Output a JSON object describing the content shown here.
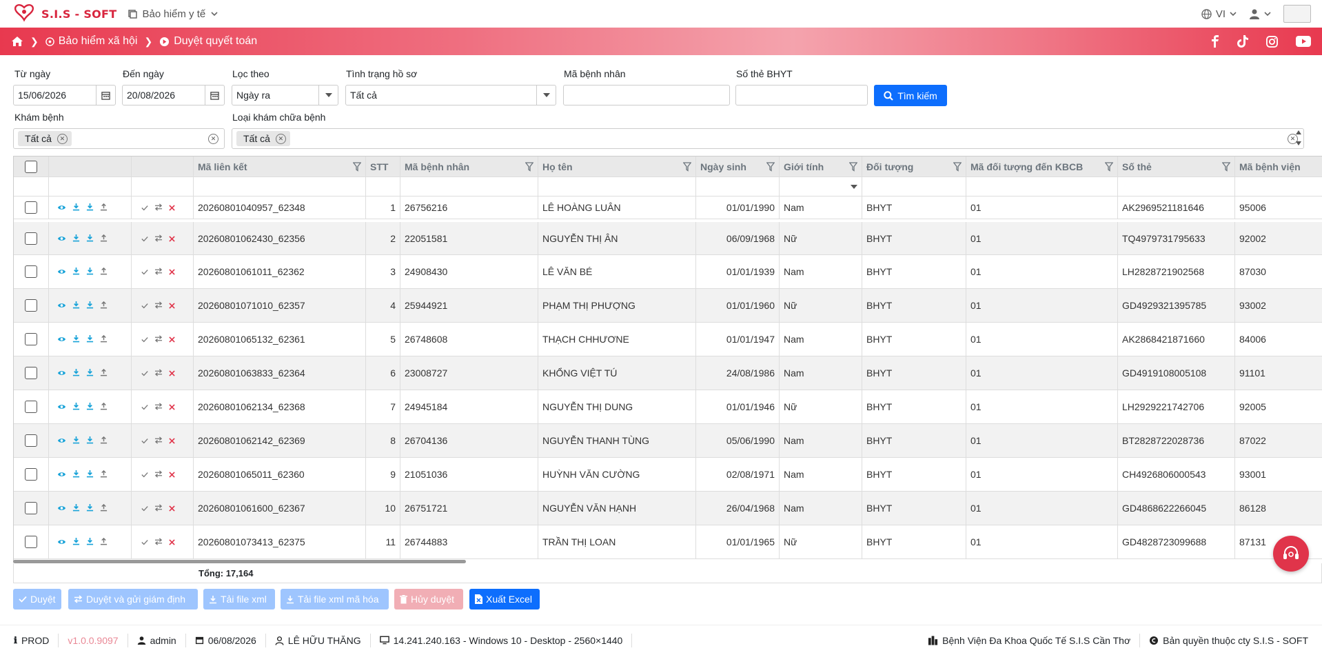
{
  "app": {
    "name": "S.I.S - SOFT",
    "module": "Bảo hiểm y tế",
    "language": "VI"
  },
  "breadcrumb": {
    "section": "Bảo hiểm xã hội",
    "page": "Duyệt quyết toán"
  },
  "filters": {
    "from_date_label": "Từ ngày",
    "from_date": "15/06/2026",
    "to_date_label": "Đến ngày",
    "to_date": "20/08/2026",
    "filter_by_label": "Lọc theo",
    "filter_by": "Ngày ra",
    "status_label": "Tình trạng hồ sơ",
    "status": "Tất cả",
    "patient_id_label": "Mã bệnh nhân",
    "patient_id": "",
    "card_label": "Số thẻ BHYT",
    "card": "",
    "search_label": "Tìm kiếm",
    "exam_label": "Khám bệnh",
    "exam_tag": "Tất cả",
    "exam_type_label": "Loại khám chữa bệnh",
    "exam_type_tag": "Tất cả"
  },
  "table": {
    "headers": [
      "Mã liên kết",
      "STT",
      "Mã bệnh nhân",
      "Họ tên",
      "Ngày sinh",
      "Giới tính",
      "Đối tượng",
      "Mã đối tượng đến KBCB",
      "Số thẻ",
      "Mã bệnh viện"
    ],
    "rows": [
      {
        "link_id": "20260801040957_62348",
        "stt": "1",
        "patient_id": "26756216",
        "name": "LÊ HOÀNG LUÂN",
        "dob": "01/01/1990",
        "gender": "Nam",
        "category": "BHYT",
        "category_code": "01",
        "card": "AK2969521181646",
        "hospital": "95006"
      },
      {
        "link_id": "20260801062430_62356",
        "stt": "2",
        "patient_id": "22051581",
        "name": "NGUYỄN THỊ ÂN",
        "dob": "06/09/1968",
        "gender": "Nữ",
        "category": "BHYT",
        "category_code": "01",
        "card": "TQ4979731795633",
        "hospital": "92002"
      },
      {
        "link_id": "20260801061011_62362",
        "stt": "3",
        "patient_id": "24908430",
        "name": "LÊ VĂN BÉ",
        "dob": "01/01/1939",
        "gender": "Nam",
        "category": "BHYT",
        "category_code": "01",
        "card": "LH2828721902568",
        "hospital": "87030"
      },
      {
        "link_id": "20260801071010_62357",
        "stt": "4",
        "patient_id": "25944921",
        "name": "PHẠM THỊ PHƯỢNG",
        "dob": "01/01/1960",
        "gender": "Nữ",
        "category": "BHYT",
        "category_code": "01",
        "card": "GD4929321395785",
        "hospital": "93002"
      },
      {
        "link_id": "20260801065132_62361",
        "stt": "5",
        "patient_id": "26748608",
        "name": "THẠCH CHHƯƠNE",
        "dob": "01/01/1947",
        "gender": "Nam",
        "category": "BHYT",
        "category_code": "01",
        "card": "AK2868421871660",
        "hospital": "84006"
      },
      {
        "link_id": "20260801063833_62364",
        "stt": "6",
        "patient_id": "23008727",
        "name": "KHỔNG VIỆT TÚ",
        "dob": "24/08/1986",
        "gender": "Nam",
        "category": "BHYT",
        "category_code": "01",
        "card": "GD4919108005108",
        "hospital": "91101"
      },
      {
        "link_id": "20260801062134_62368",
        "stt": "7",
        "patient_id": "24945184",
        "name": "NGUYỄN THỊ DUNG",
        "dob": "01/01/1946",
        "gender": "Nữ",
        "category": "BHYT",
        "category_code": "01",
        "card": "LH2929221742706",
        "hospital": "92005"
      },
      {
        "link_id": "20260801062142_62369",
        "stt": "8",
        "patient_id": "26704136",
        "name": "NGUYỄN THANH TÙNG",
        "dob": "05/06/1990",
        "gender": "Nam",
        "category": "BHYT",
        "category_code": "01",
        "card": "BT2828722028736",
        "hospital": "87022"
      },
      {
        "link_id": "20260801065011_62360",
        "stt": "9",
        "patient_id": "21051036",
        "name": "HUỲNH VĂN CƯỜNG",
        "dob": "02/08/1971",
        "gender": "Nam",
        "category": "BHYT",
        "category_code": "01",
        "card": "CH4926806000543",
        "hospital": "93001"
      },
      {
        "link_id": "20260801061600_62367",
        "stt": "10",
        "patient_id": "26751721",
        "name": "NGUYỄN VĂN HẠNH",
        "dob": "26/04/1968",
        "gender": "Nam",
        "category": "BHYT",
        "category_code": "01",
        "card": "GD4868622266045",
        "hospital": "86128"
      },
      {
        "link_id": "20260801073413_62375",
        "stt": "11",
        "patient_id": "26744883",
        "name": "TRẦN THỊ LOAN",
        "dob": "01/01/1965",
        "gender": "Nữ",
        "category": "BHYT",
        "category_code": "01",
        "card": "GD4828723099688",
        "hospital": "87131"
      }
    ],
    "total_label": "Tổng: 17,164"
  },
  "actions": {
    "approve": "Duyệt",
    "approve_send": "Duyệt và gửi giám định",
    "download_xml": "Tải file xml",
    "download_xml_encrypted": "Tải file xml mã hóa",
    "cancel_approve": "Hủy duyệt",
    "export_excel": "Xuất Excel"
  },
  "footer": {
    "env": "PROD",
    "version": "v1.0.0.9097",
    "user": "admin",
    "date": "06/08/2026",
    "doctor": "LÊ HỮU THĂNG",
    "device": "14.241.240.163 - Windows 10 - Desktop - 2560×1440",
    "hospital": "Bệnh Viện Đa Khoa Quốc Tế S.I.S Cần Thơ",
    "copyright": "Bản quyền thuộc cty S.I.S - SOFT"
  },
  "colors": {
    "brand": "#d8253e",
    "primary": "#0d6efd",
    "eye_icon": "#17a2d8"
  }
}
